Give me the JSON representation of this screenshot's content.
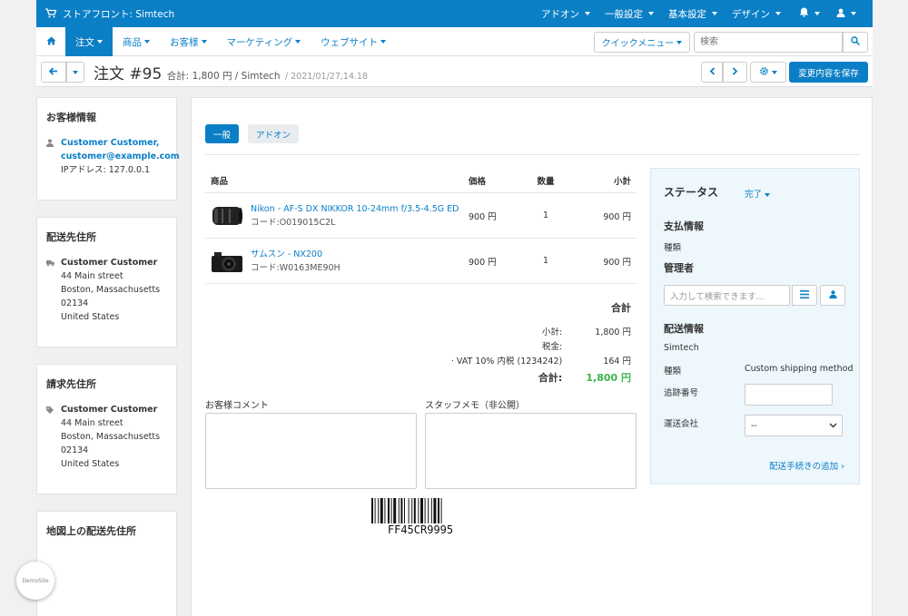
{
  "topbar": {
    "brand": "ストアフロント: Simtech",
    "menus": [
      "アドオン",
      "一般設定",
      "基本設定",
      "デザイン"
    ]
  },
  "nav": {
    "items": [
      "注文",
      "商品",
      "お客様",
      "マーケティング",
      "ウェブサイト"
    ],
    "quick_menu": "クイックメニュー",
    "search_placeholder": "検索"
  },
  "title": {
    "main": "注文 #95",
    "subtitle": "合計: 1,800 円 / Simtech",
    "date": "/ 2021/01/27,14.18",
    "save_label": "変更内容を保存"
  },
  "sidebar": {
    "customer": {
      "heading": "お客様情報",
      "name": "Customer Customer,",
      "email": "customer@example.com",
      "ip": "IPアドレス: 127.0.0.1"
    },
    "shipping": {
      "heading": "配送先住所",
      "name": "Customer Customer",
      "lines": [
        "44 Main street",
        "Boston, Massachusetts",
        "02134",
        "United States"
      ]
    },
    "billing": {
      "heading": "請求先住所",
      "name": "Customer Customer",
      "lines": [
        "44 Main street",
        "Boston, Massachusetts",
        "02134",
        "United States"
      ]
    },
    "map": {
      "heading": "地図上の配送先住所"
    }
  },
  "tabs": [
    "一般",
    "アドオン"
  ],
  "products": {
    "headers": [
      "商品",
      "価格",
      "数量",
      "小計"
    ],
    "rows": [
      {
        "name": "Nikon - AF-S DX NIKKOR 10-24mm f/3.5-4.5G ED",
        "code": "コード:O019015C2L",
        "price": "900 円",
        "qty": "1",
        "subtotal": "900 円"
      },
      {
        "name": "サムスン - NX200",
        "code": "コード:W0163ME90H",
        "price": "900 円",
        "qty": "1",
        "subtotal": "900 円"
      }
    ]
  },
  "totals": {
    "heading": "合計",
    "subtotal_label": "小計:",
    "subtotal_value": "1,800 円",
    "tax_label": "税金:",
    "vat_label": "· VAT 10% 内税 (1234242)",
    "vat_value": "164 円",
    "total_label": "合計:",
    "total_value": "1,800 円",
    "total_color": "#3cb44b"
  },
  "comments": {
    "customer_label": "お客様コメント",
    "staff_label": "スタッフメモ（非公開）"
  },
  "barcode": {
    "text": "FF45CR9995"
  },
  "status_panel": {
    "status_heading": "ステータス",
    "status_value": "完了",
    "payment_heading": "支払情報",
    "payment_type": "種類",
    "manager_heading": "管理者",
    "manager_placeholder": "入力して検索できます...",
    "shipping_heading": "配送情報",
    "shipping_company": "Simtech",
    "shipping_type_label": "種類",
    "shipping_type_value": "Custom shipping method",
    "tracking_label": "追跡番号",
    "carrier_label": "運送会社",
    "carrier_value": "--",
    "add_shipment": "配送手続きの追加"
  },
  "demo_badge": "DemoSite"
}
